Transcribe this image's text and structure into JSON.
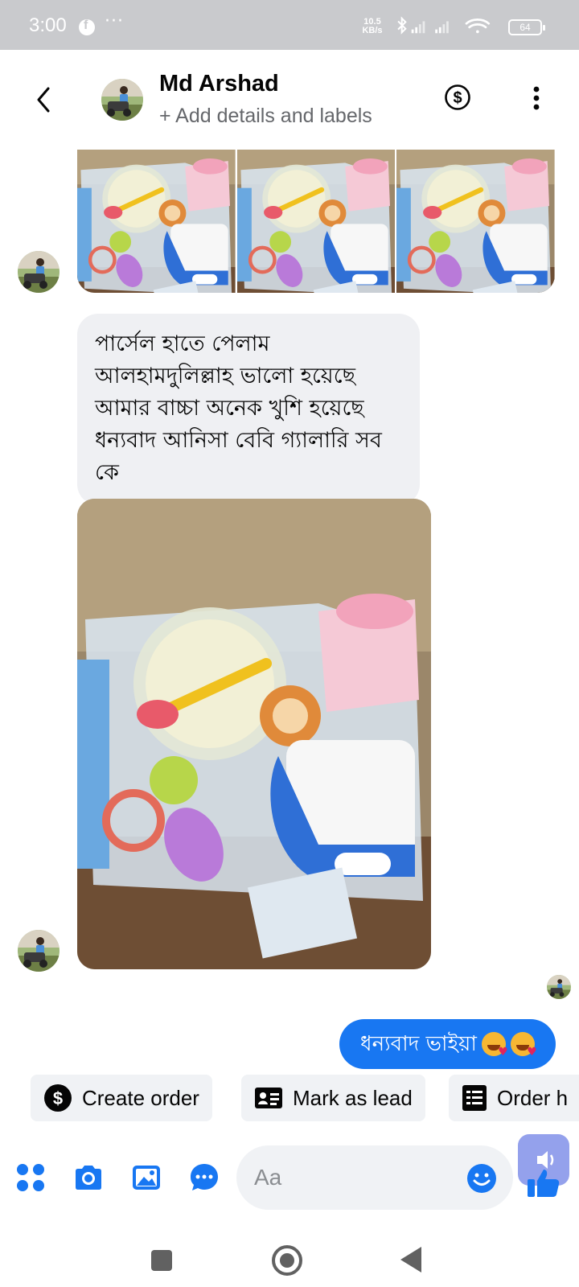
{
  "status_bar": {
    "time": "3:00",
    "more": "···",
    "net_speed_value": "10.5",
    "net_speed_unit": "KB/s",
    "battery": "64"
  },
  "header": {
    "contact_name": "Md Arshad",
    "subtitle": "+ Add details and labels",
    "icons": [
      "back-icon",
      "dollar-icon",
      "more-vertical-icon"
    ]
  },
  "messages": {
    "incoming_text": "পার্সেল হাতে পেলাম আলহামদুলিল্লাহ ভালো হয়েছে আমার বাচ্চা অনেক খুশি হয়েছে ধন্যবাদ আনিসা বেবি গ্যালারি সব কে",
    "outgoing_text": "ধন্যবাদ ভাইয়া",
    "outgoing_emoji": [
      "smiling-face-with-hearts",
      "smiling-face-with-hearts"
    ],
    "photo_strip_count": 3
  },
  "quick_actions": {
    "create_order": "Create order",
    "mark_as_lead": "Mark as lead",
    "order_history": "Order h"
  },
  "composer": {
    "placeholder": "Aa",
    "icons": [
      "apps-icon",
      "camera-icon",
      "image-icon",
      "chat-bubble-icon",
      "emoji-icon",
      "like-icon"
    ]
  },
  "colors": {
    "accent": "#1877f2",
    "incoming_bubble": "#eff0f3",
    "chip_bg": "#f0f2f5",
    "status_bar": "#c9cacd"
  }
}
